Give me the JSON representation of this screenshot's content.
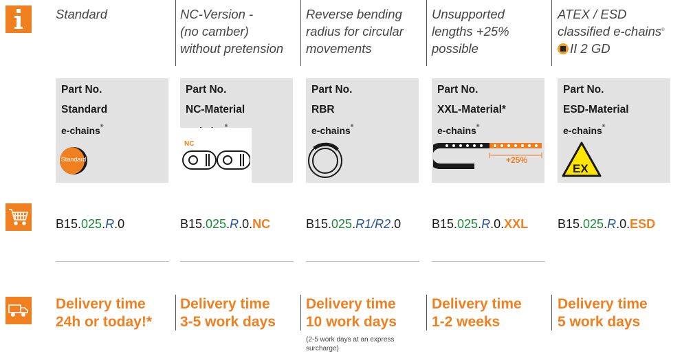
{
  "info_icon": "info-icon",
  "cart_icon": "shopping-cart-icon",
  "truck_icon": "delivery-truck-icon",
  "columns": [
    {
      "desc": [
        "Standard"
      ],
      "part_label": "Part No.",
      "material": "Standard",
      "echains": "e-chains",
      "image_label": "Standard",
      "part": {
        "prefix": "B15.",
        "green": "025",
        "dot1": ".",
        "blue": "R",
        "dot2": ".0",
        "suffix": ""
      },
      "delivery": [
        "Delivery time",
        "24h or today!*"
      ]
    },
    {
      "desc": [
        "NC-Version -",
        "(no camber)",
        "without pretension"
      ],
      "part_label": "Part No.",
      "material": "NC-Material",
      "echains": "e-chains",
      "image_label": "NC",
      "part": {
        "prefix": "B15.",
        "green": "025",
        "dot1": ".",
        "blue": "R",
        "dot2": ".0.",
        "suffix": "NC"
      },
      "delivery": [
        "Delivery time",
        "3-5 work days"
      ]
    },
    {
      "desc": [
        "Reverse bending",
        "radius for circular",
        "movements"
      ],
      "part_label": "Part No.",
      "material": "RBR",
      "echains": "e-chains",
      "part": {
        "prefix": "B15.",
        "green": "025",
        "dot1": ".",
        "blue": "R1/R2",
        "dot2": ".0",
        "suffix": ""
      },
      "delivery": [
        "Delivery time",
        "10 work days"
      ],
      "note": "(2-5 work days at an express surcharge)"
    },
    {
      "desc": [
        "Unsupported",
        "lengths +25%",
        "possible"
      ],
      "part_label": "Part No.",
      "material": "XXL-Material*",
      "echains": "e-chains",
      "image_label": "+25%",
      "part": {
        "prefix": "B15.",
        "green": "025",
        "dot1": ".",
        "blue": "R",
        "dot2": ".0.",
        "suffix": "XXL"
      },
      "delivery": [
        "Delivery time",
        "1-2 weeks"
      ]
    },
    {
      "desc": [
        "ATEX / ESD",
        "classified e-chains",
        "II 2 GD"
      ],
      "part_label": "Part No.",
      "material": "ESD-Material",
      "echains": "e-chains",
      "image_label": "EX",
      "part": {
        "prefix": "B15.",
        "green": "025",
        "dot1": ".",
        "blue": "R",
        "dot2": ".0.",
        "suffix": "ESD"
      },
      "delivery": [
        "Delivery time",
        "5 work days"
      ]
    }
  ],
  "colors": {
    "accent": "#f07f20",
    "green": "#1c8a3a",
    "blue": "#2455a4",
    "panel": "#e2e2e2"
  }
}
